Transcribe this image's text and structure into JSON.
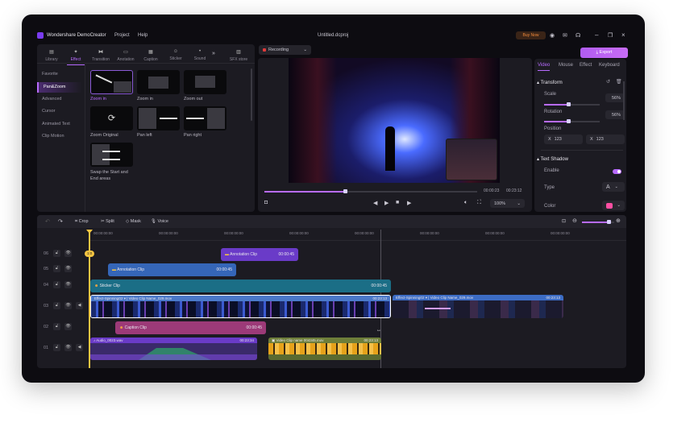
{
  "app": {
    "name": "Wondershare DemoCreator",
    "menu": [
      "Project",
      "Help"
    ],
    "file": "Untitled.dcproj",
    "buy": "Buy Now"
  },
  "left": {
    "tabs": [
      {
        "label": "Library",
        "icon": "library-icon"
      },
      {
        "label": "Effect",
        "icon": "effect-icon"
      },
      {
        "label": "Transition",
        "icon": "transition-icon"
      },
      {
        "label": "Anotation",
        "icon": "annotation-icon"
      },
      {
        "label": "Caption",
        "icon": "caption-icon"
      },
      {
        "label": "Sticker",
        "icon": "sticker-icon"
      },
      {
        "label": "Sound",
        "icon": "sound-icon"
      },
      {
        "label": "SFX store",
        "icon": "store-icon"
      }
    ],
    "active_tab": "Effect",
    "categories": [
      "Favorite",
      "Pan&Zoom",
      "Advanced",
      "Cursor",
      "Animated Text",
      "Clip Motion"
    ],
    "active_category": "Pan&Zoom",
    "effects": [
      "Zoom in",
      "Zoom in",
      "Zoom out",
      "Zoom Original",
      "Pan left",
      "Pan right",
      "Swap the Start and End areas"
    ]
  },
  "preview": {
    "mode": "Recording",
    "current": "00:00:23",
    "total": "00:23:12",
    "zoom": "100%",
    "progress": 0.38
  },
  "export_label": "Export",
  "right": {
    "tabs": [
      "Video",
      "Mouse",
      "Effect",
      "Keyboard"
    ],
    "transform": {
      "title": "Transform",
      "scale_label": "Scale",
      "scale": "56%",
      "rotation_label": "Rotation",
      "rotation": "56%",
      "position_label": "Position",
      "x_label": "X",
      "x": "123",
      "y_label": "X",
      "y": "123"
    },
    "shadow": {
      "title": "Text Shadow",
      "enable_label": "Enable",
      "enabled": true,
      "type_label": "Type",
      "type": "A",
      "color_label": "Color",
      "color": "#ff4fa3"
    }
  },
  "timeline": {
    "tools": [
      "Crop",
      "Split",
      "Mask",
      "Voice"
    ],
    "ruler": [
      "00:00:00:00",
      "00:00:00:00",
      "00:00:00:00",
      "00:00:00:00",
      "00:00:00:00",
      "00:00:00:00",
      "00:00:00:00",
      "00:00:00:00"
    ],
    "playhead": "1:0",
    "rows": [
      "06",
      "05",
      "04",
      "03",
      "02",
      "01"
    ],
    "clips": {
      "ann6": {
        "label": "Annotation Clip",
        "dur": "00:00:45"
      },
      "ann5": {
        "label": "Annotation Clip",
        "dur": "00:00:45"
      },
      "sticker": {
        "label": "Sticker Clip",
        "dur": "00:00:45"
      },
      "video1": {
        "effect": "Effect-Spinning02",
        "label": "Video Clip Name_029.mov",
        "dur": "00:23:13"
      },
      "video2": {
        "effect": "Effect-Spinning02",
        "label": "Video Clip Name_029.mov",
        "dur": "00:23:13"
      },
      "caption": {
        "label": "Caption Clip",
        "dur": "00:00:45"
      },
      "audio": {
        "label": "Audio_0023.wav",
        "dur": "00:23:34"
      },
      "video3": {
        "label": "Video Clip name 004345.mov",
        "dur": "00:23:13"
      }
    }
  }
}
